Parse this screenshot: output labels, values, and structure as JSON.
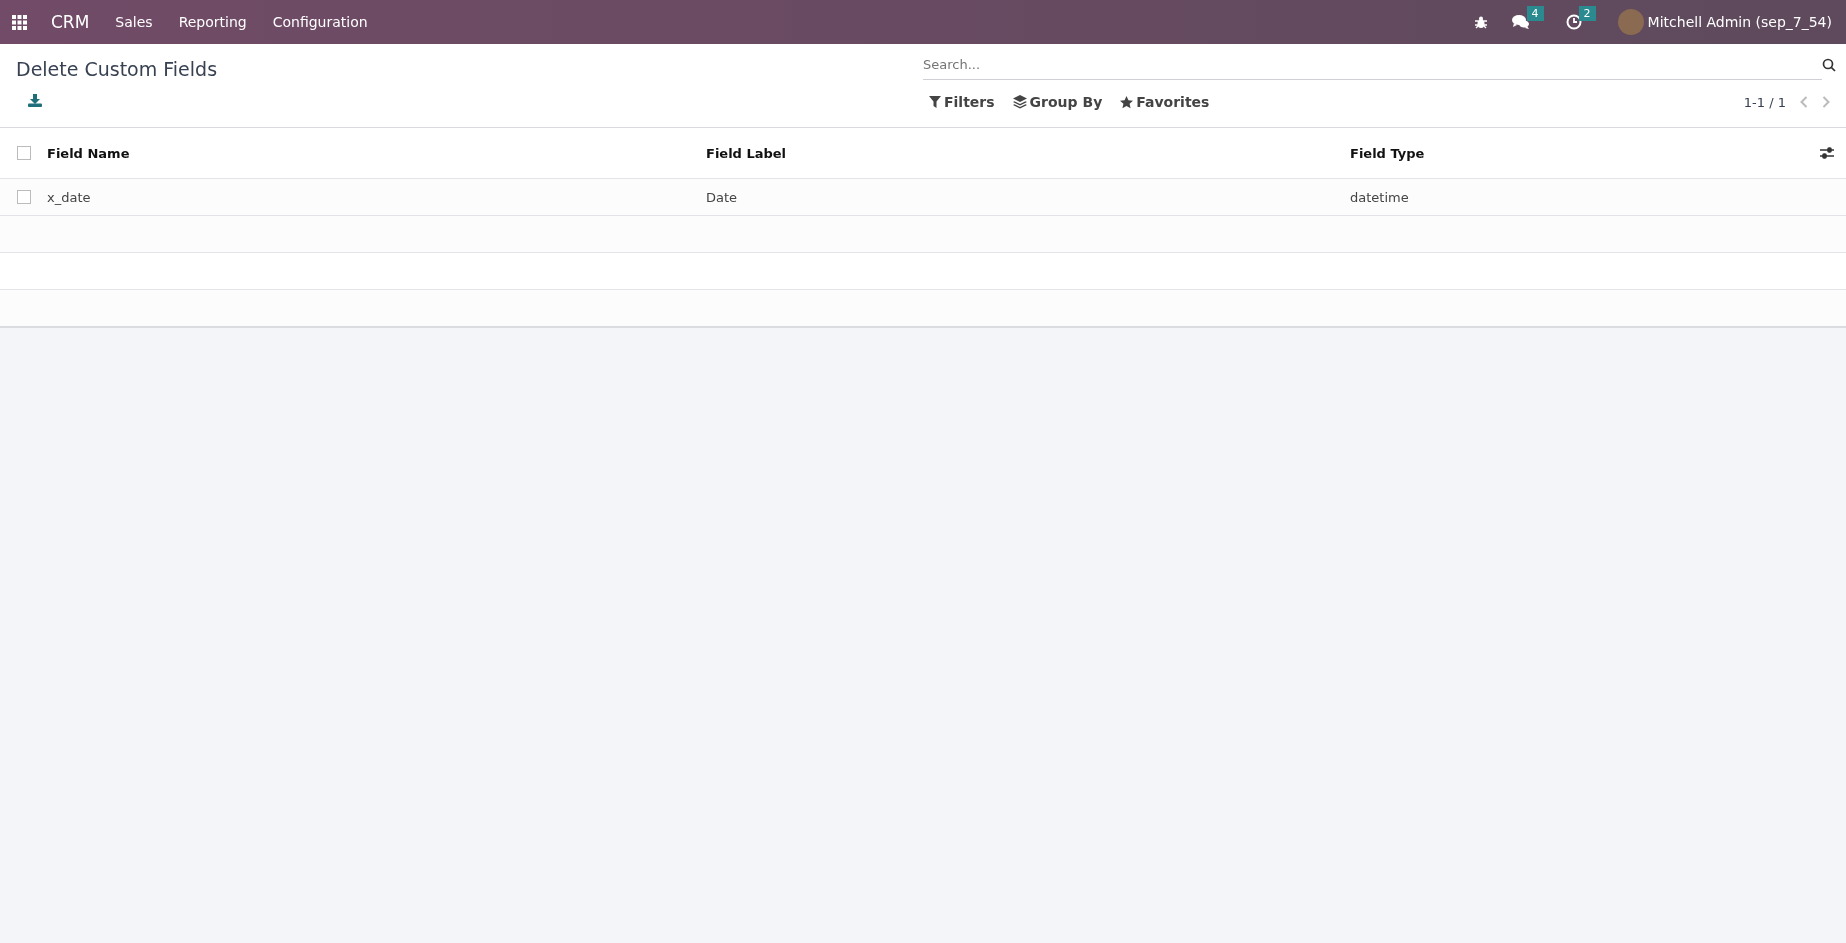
{
  "navbar": {
    "app": "CRM",
    "menu": [
      "Sales",
      "Reporting",
      "Configuration"
    ],
    "messages_badge": "4",
    "activities_badge": "2",
    "user": "Mitchell Admin (sep_7_54)"
  },
  "page": {
    "title": "Delete Custom Fields"
  },
  "search": {
    "placeholder": "Search..."
  },
  "search_options": [
    "Filters",
    "Group By",
    "Favorites"
  ],
  "pager": "1-1 / 1",
  "table": {
    "select_all": {
      "checked": false
    },
    "columns": [
      "Field Name",
      "Field Label",
      "Field Type"
    ],
    "rows": [
      {
        "checked": false,
        "cells": [
          "x_date",
          "Date",
          "datetime"
        ]
      }
    ]
  }
}
